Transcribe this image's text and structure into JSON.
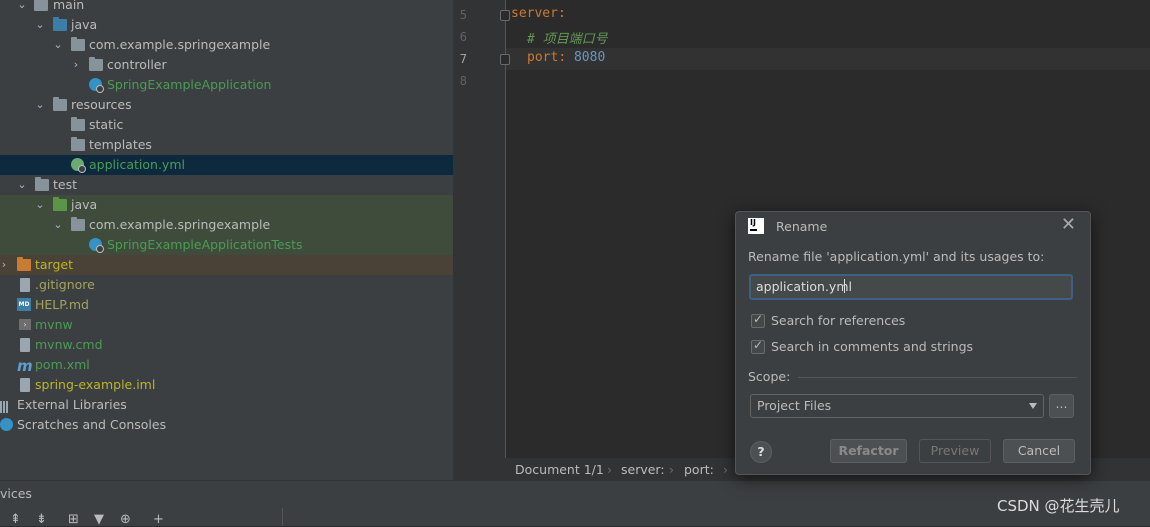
{
  "project_tree": {
    "main": "main",
    "java": "java",
    "package": "com.example.springexample",
    "controller": "controller",
    "app_class": "SpringExampleApplication",
    "resources": "resources",
    "static": "static",
    "templates": "templates",
    "application_yml": "application.yml",
    "test": "test",
    "test_java": "java",
    "test_package": "com.example.springexample",
    "test_class": "SpringExampleApplicationTests",
    "target": "target",
    "gitignore": ".gitignore",
    "help_md": "HELP.md",
    "md_badge": "MD",
    "mvnw": "mvnw",
    "mvnw_cmd": "mvnw.cmd",
    "pom": "pom.xml",
    "iml": "spring-example.iml",
    "external_libraries": "External Libraries",
    "scratches": "Scratches and Consoles"
  },
  "editor": {
    "line_numbers": [
      "5",
      "6",
      "7",
      "8"
    ],
    "current_line": "7",
    "line5_key": "server",
    "line5_colon": ":",
    "line6_comment": "# 项目端口号",
    "line7_key": "port",
    "line7_colon": ":",
    "line7_value": "8080"
  },
  "breadcrumb": {
    "document": "Document 1/1",
    "sep": "›",
    "item1": "server:",
    "item2": "port:"
  },
  "bottom_panel": {
    "title": "vices",
    "tools": [
      "⇞",
      "⇟",
      "⊞",
      "▼",
      "⊕",
      "+"
    ]
  },
  "watermark": "CSDN @花生壳儿",
  "dialog": {
    "title": "Rename",
    "close": "✕",
    "prompt": "Rename file 'application.yml' and its usages to:",
    "input_value": "application.yml",
    "search_references": "Search for references",
    "search_comments": "Search in comments and strings",
    "search_references_checked": true,
    "search_comments_checked": true,
    "scope_label": "Scope:",
    "scope_value": "Project Files",
    "browse": "...",
    "help": "?",
    "refactor": "Refactor",
    "preview": "Preview",
    "cancel": "Cancel"
  },
  "colors": {
    "tree_bg": "#3c3f41",
    "editor_bg": "#2b2b2b",
    "selection": "#0d293e",
    "test_bg": "#3f4c3c",
    "excluded_bg": "#4a4236",
    "keyword": "#cc7832",
    "comment": "#629755",
    "number": "#6897bb"
  }
}
